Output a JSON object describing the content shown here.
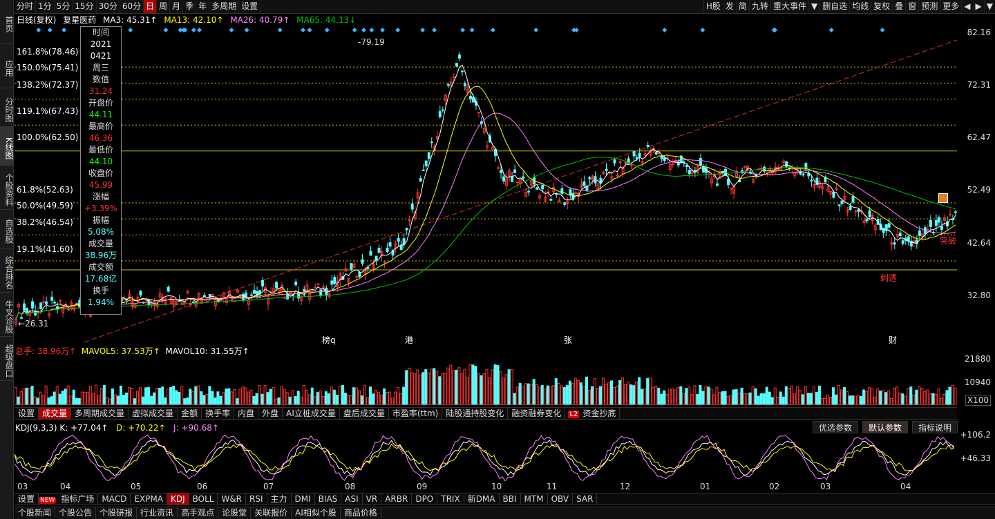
{
  "sidebar": [
    "首页",
    "应用",
    "分时图",
    "K线图",
    "个股资料",
    "自选股",
    "综合排名",
    "牛叉诊股",
    "超级盘口"
  ],
  "periods": [
    "分时",
    "1分",
    "5分",
    "15分",
    "30分",
    "60分",
    "日",
    "周",
    "月",
    "季",
    "年",
    "多周期",
    "设置"
  ],
  "tools": [
    "H股",
    "发",
    "简",
    "九转",
    "重大事件",
    "▼",
    "删自选",
    "均线",
    "复权",
    "叠",
    "窗",
    "预测",
    "更多",
    "◀",
    "▶",
    "▼"
  ],
  "ma_line": {
    "title": "日线(复权)",
    "stock": "复星医药",
    "ma3": "MA3: 45.31↑",
    "ma13": "MA13: 42.10↑",
    "ma26": "MA26: 40.79↑",
    "ma65": "MA65: 44.13↓"
  },
  "price_axis": [
    "82.16",
    "72.31",
    "62.47",
    "52.49",
    "42.64",
    "32.80"
  ],
  "fib_labels": [
    "161.8%(78.46)",
    "150.0%(75.41)",
    "138.2%(72.37)",
    "119.1%(67.43)",
    "100.0%(62.50)",
    "61.8%(52.63)",
    "50.0%(49.59)",
    "38.2%(46.54)",
    "19.1%(41.60)"
  ],
  "high_label": "79.19",
  "low_label": "26.31",
  "info": {
    "time_label": "时间",
    "year": "2021",
    "date": "0421",
    "weekday": "周三",
    "value_label": "数值",
    "value": "31.24",
    "open_label": "开盘价",
    "open": "44.11",
    "high_label": "最高价",
    "high": "46.36",
    "low_label": "最低价",
    "low": "44.10",
    "close_label": "收盘价",
    "close": "45.99",
    "chg_label": "涨幅",
    "chg": "+3.39%",
    "amp_label": "振幅",
    "amp": "5.08%",
    "vol_label": "成交量",
    "vol": "38.96万",
    "amt_label": "成交额",
    "amt": "17.68亿",
    "turn_label": "换手",
    "turn": "1.94%"
  },
  "events": [
    "榜q",
    "港",
    "张",
    "财"
  ],
  "tags": [
    "突破",
    "刺透"
  ],
  "vol_hdr": {
    "total": "总手: 38.96万↑",
    "mavol5": "MAVOL5: 37.53万↑",
    "mavol10": "MAVOL10: 31.55万↑"
  },
  "vol_axis": [
    "21880",
    "10940",
    "X100"
  ],
  "vol_tabs": [
    "设置",
    "成交量",
    "多周期成交量",
    "虚拟成交量",
    "金额",
    "换手率",
    "内盘",
    "外盘",
    "AI立桩成交量",
    "盘后成交量",
    "市盈率(ttm)",
    "陆股通持股变化",
    "融资融券变化",
    "资金抄底"
  ],
  "kdj_hdr": {
    "name": "KDJ(9,3,3)",
    "k": "K: +77.04↑",
    "d": "D: +70.22↑",
    "j": "J: +90.68↑"
  },
  "kdj_axis": [
    "+106.2",
    "+46.33"
  ],
  "kdj_buttons": [
    "优选参数",
    "默认参数",
    "指标说明"
  ],
  "months": [
    "03",
    "04",
    "05",
    "06",
    "07",
    "08",
    "09",
    "10",
    "11",
    "12",
    "01",
    "02",
    "03",
    "04"
  ],
  "ind_tabs": [
    "设置",
    "指标广场",
    "MACD",
    "EXPMA",
    "KDJ",
    "BOLL",
    "W&R",
    "RSI",
    "主力",
    "DMI",
    "BIAS",
    "ASI",
    "VR",
    "ARBR",
    "DPO",
    "TRIX",
    "新DMA",
    "BBI",
    "MTM",
    "OBV",
    "SAR"
  ],
  "new_badge": "NEW",
  "l2_badge": "L2",
  "bottom_tabs": [
    "个股新闻",
    "个股公告",
    "个股研报",
    "行业资讯",
    "高手观点",
    "论股堂",
    "关联报价",
    "AI相似个股",
    "商品价格"
  ],
  "colors": {
    "up": "#ff3232",
    "down": "#54ffff",
    "ma3": "#ffffff",
    "ma13": "#ffff00",
    "ma26": "#ff80ff",
    "ma65": "#00c000"
  }
}
